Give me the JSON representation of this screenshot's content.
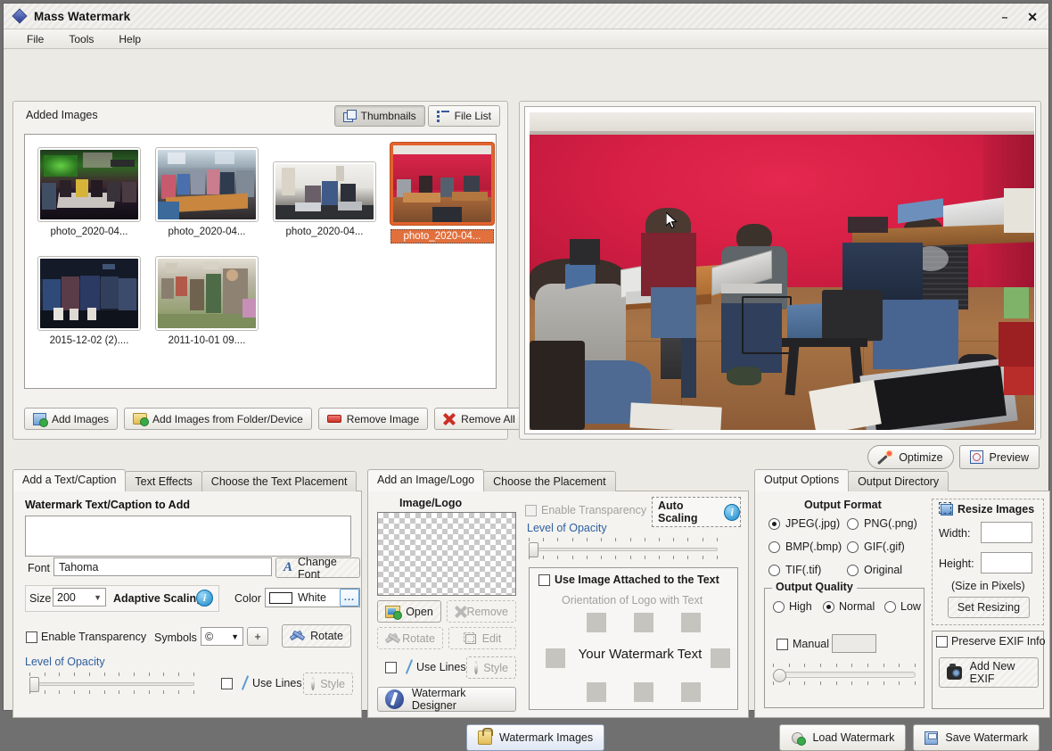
{
  "window": {
    "title": "Mass Watermark",
    "app_icon": "diamond-logo-icon",
    "minimize": "–",
    "close": "✕"
  },
  "menubar": {
    "items": [
      "File",
      "Tools",
      "Help"
    ]
  },
  "added_images": {
    "title": "Added Images",
    "view_buttons": [
      {
        "label": "Thumbnails",
        "icon": "thumbnails-icon",
        "active": true
      },
      {
        "label": "File List",
        "icon": "list-icon",
        "active": false
      }
    ],
    "thumbnails": [
      {
        "name": "photo_2020-04...",
        "selected": false
      },
      {
        "name": "photo_2020-04...",
        "selected": false
      },
      {
        "name": "photo_2020-04...",
        "selected": false
      },
      {
        "name": "photo_2020-04...",
        "selected": true
      },
      {
        "name": "2015-12-02 (2)....",
        "selected": false
      },
      {
        "name": "2011-10-01 09....",
        "selected": false
      }
    ],
    "buttons": [
      {
        "label": "Add Images",
        "icon": "add-image-icon"
      },
      {
        "label": "Add Images from Folder/Device",
        "icon": "folder-add-icon"
      },
      {
        "label": "Remove Image",
        "icon": "remove-icon"
      },
      {
        "label": "Remove All",
        "icon": "red-x-icon"
      }
    ]
  },
  "preview": {
    "optimize_label": "Optimize",
    "preview_label": "Preview",
    "wall_color": "#d81f45"
  },
  "text_panel": {
    "tabs": [
      {
        "label": "Add a Text/Caption",
        "active": true
      },
      {
        "label": "Text Effects",
        "active": false
      },
      {
        "label": "Choose the Text Placement",
        "active": false
      }
    ],
    "heading": "Watermark Text/Caption to Add",
    "text_value": "",
    "font_label": "Font",
    "font_value": "Tahoma",
    "change_font_label": "Change Font",
    "size_label": "Size",
    "size_value": "200",
    "adaptive_scaling_label": "Adaptive Scaling",
    "info_icon": "info-icon",
    "color_label": "Color",
    "color_value": "White",
    "color_more_label": "...",
    "enable_transparency_label": "Enable Transparency",
    "enable_transparency_checked": false,
    "symbols_label": "Symbols",
    "symbols_value": "©",
    "add_symbol_label": "+",
    "rotate_label": "Rotate",
    "opacity_label": "Level of Opacity",
    "use_lines_label": "Use Lines",
    "use_lines_checked": false,
    "style_label": "Style"
  },
  "image_panel": {
    "tabs": [
      {
        "label": "Add an Image/Logo",
        "active": true
      },
      {
        "label": "Choose the Placement",
        "active": false
      }
    ],
    "image_logo_label": "Image/Logo",
    "enable_transparency_label": "Enable Transparency",
    "enable_transparency_checked": false,
    "auto_scaling_label": "Auto Scaling",
    "info_icon": "info-icon",
    "opacity_label": "Level of Opacity",
    "use_image_attached_label": "Use Image Attached to the Text",
    "use_image_attached_checked": false,
    "orientation_label": "Orientation of Logo with Text",
    "watermark_text_sample": "Your Watermark Text",
    "open_label": "Open",
    "remove_label": "Remove",
    "rotate_label": "Rotate",
    "edit_label": "Edit",
    "use_lines_label": "Use Lines",
    "use_lines_checked": false,
    "style_label": "Style",
    "designer_label": "Watermark Designer"
  },
  "output_panel": {
    "tabs": [
      {
        "label": "Output Options",
        "active": true
      },
      {
        "label": "Output Directory",
        "active": false
      }
    ],
    "format_title": "Output Format",
    "formats": [
      {
        "label": "JPEG(.jpg)",
        "selected": true
      },
      {
        "label": "PNG(.png)",
        "selected": false
      },
      {
        "label": "BMP(.bmp)",
        "selected": false
      },
      {
        "label": "GIF(.gif)",
        "selected": false
      },
      {
        "label": "TIF(.tif)",
        "selected": false
      },
      {
        "label": "Original",
        "selected": false
      }
    ],
    "quality_title": "Output Quality",
    "qualities": [
      {
        "label": "High",
        "selected": false
      },
      {
        "label": "Normal",
        "selected": true
      },
      {
        "label": "Low",
        "selected": false
      }
    ],
    "manual_label": "Manual",
    "manual_checked": false,
    "manual_value": "",
    "resize_title": "Resize Images",
    "resize_icon": "resize-icon",
    "width_label": "Width:",
    "width_value": "",
    "height_label": "Height:",
    "height_value": "",
    "size_note": "(Size in Pixels)",
    "set_resizing_label": "Set Resizing",
    "preserve_exif_label": "Preserve EXIF Info",
    "preserve_exif_checked": false,
    "add_exif_label": "Add New EXIF",
    "camera_icon": "camera-icon"
  },
  "footer": {
    "watermark_images_label": "Watermark Images",
    "load_watermark_label": "Load Watermark",
    "save_watermark_label": "Save Watermark"
  }
}
